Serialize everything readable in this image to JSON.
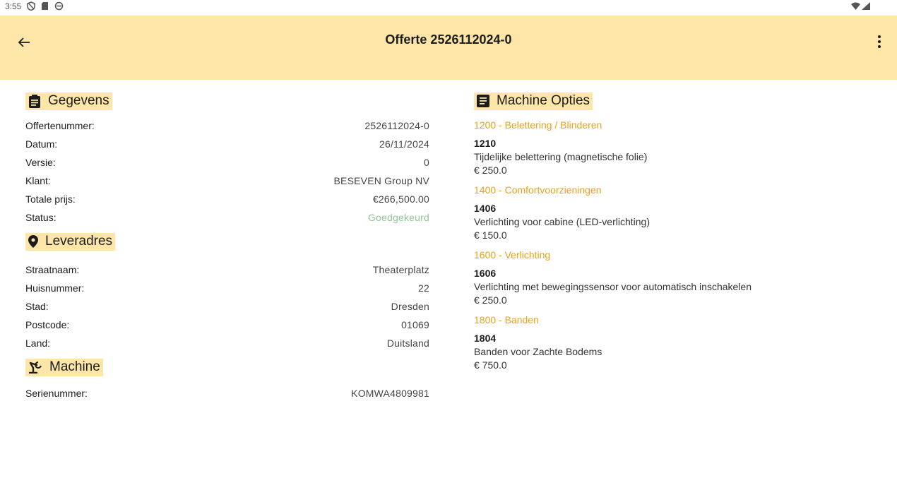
{
  "status_bar": {
    "time": "3:55",
    "left_icons": [
      "shield-icon",
      "sd-card-icon",
      "sync-icon"
    ],
    "right_icons": [
      "wifi-icon",
      "signal-icon"
    ]
  },
  "app_bar": {
    "title": "Offerte 2526112024-0",
    "back_icon": "arrow-back-icon",
    "menu_icon": "more-vert-icon",
    "background": "#fde6a8"
  },
  "gegevens": {
    "heading": "Gegevens",
    "icon": "clipboard-icon",
    "rows": [
      {
        "label": "Offertenummer:",
        "value": "2526112024-0"
      },
      {
        "label": "Datum:",
        "value": "26/11/2024"
      },
      {
        "label": "Versie:",
        "value": "0"
      },
      {
        "label": "Klant:",
        "value": "BESEVEN Group NV"
      },
      {
        "label": "Totale prijs:",
        "value": "€266,500.00"
      },
      {
        "label": "Status:",
        "value": "Goedgekeurd"
      }
    ],
    "status_color": "#8fc49a"
  },
  "leveradres": {
    "heading": "Leveradres",
    "icon": "location-pin-icon",
    "rows": [
      {
        "label": "Straatnaam:",
        "value": "Theaterplatz"
      },
      {
        "label": "Huisnummer:",
        "value": "22"
      },
      {
        "label": "Stad:",
        "value": "Dresden"
      },
      {
        "label": "Postcode:",
        "value": "01069"
      },
      {
        "label": "Land:",
        "value": "Duitsland"
      }
    ]
  },
  "machine": {
    "heading": "Machine",
    "icon": "excavator-icon",
    "rows": [
      {
        "label": "Serienummer:",
        "value": "KOMWA4809981"
      }
    ]
  },
  "machine_opties": {
    "heading": "Machine Opties",
    "icon": "document-icon",
    "accent_color": "#e8a21a",
    "groups": [
      {
        "title": "1200 - Belettering / Blinderen",
        "code": "1210",
        "description": "Tijdelijke belettering (magnetische folie)",
        "price": "€ 250.0"
      },
      {
        "title": "1400 - Comfortvoorzieningen",
        "code": "1406",
        "description": "Verlichting voor cabine (LED-verlichting)",
        "price": "€ 150.0"
      },
      {
        "title": "1600 - Verlichting",
        "code": "1606",
        "description": "Verlichting met bewegingssensor voor automatisch inschakelen",
        "price": "€ 250.0"
      },
      {
        "title": "1800 - Banden",
        "code": "1804",
        "description": "Banden voor Zachte Bodems",
        "price": "€ 750.0"
      }
    ]
  }
}
